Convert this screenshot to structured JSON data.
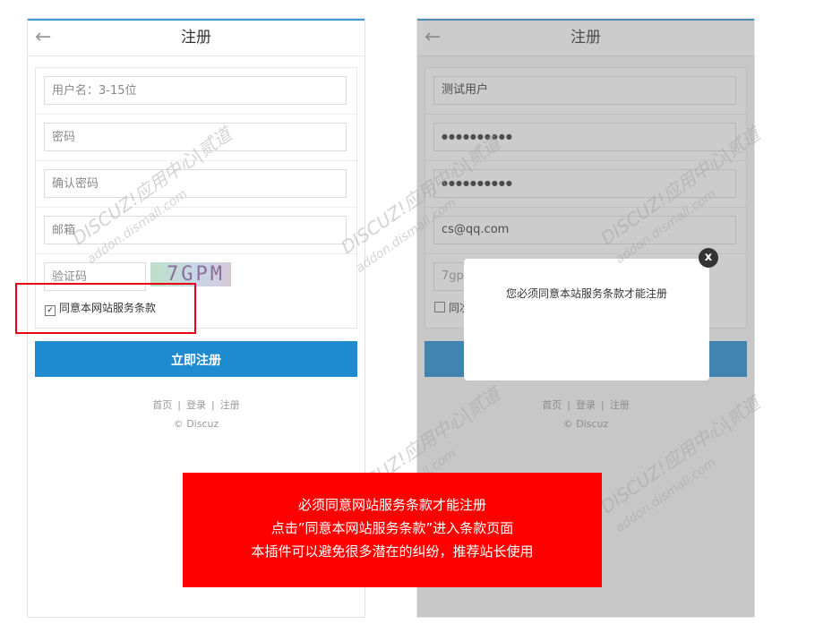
{
  "left_form": {
    "header_title": "注册",
    "username_placeholder": "用户名：3-15位",
    "password_placeholder": "密码",
    "confirm_placeholder": "确认密码",
    "email_placeholder": "邮箱",
    "captcha_placeholder": "验证码",
    "captcha_text": "7GPM",
    "agree_label": "同意本网站服务条款",
    "submit_label": "立即注册",
    "footer_links": [
      "首页",
      "登录",
      "注册"
    ],
    "copyright": "© Discuz"
  },
  "right_form": {
    "header_title": "注册",
    "username_value": "测试用户",
    "password_value": "●●●●●●●●●●",
    "confirm_value": "●●●●●●●●●●",
    "email_value": "cs@qq.com",
    "captcha_value": "7gp",
    "agree_label_partial": "同次",
    "footer_links": [
      "首页",
      "登录",
      "注册"
    ],
    "copyright": "© Discuz",
    "modal_message": "您必须同意本站服务条款才能注册",
    "modal_close": "x"
  },
  "banner": {
    "line1": "必须同意网站服务条款才能注册",
    "line2": "点击”同意本网站服务条款”进入条款页面",
    "line3": "本插件可以避免很多潜在的纠纷，推荐站长使用"
  },
  "watermark": {
    "text": "DISCUZ!应用中心|贰道",
    "subtext": "addon.dismall.com"
  },
  "colors": {
    "accent": "#1e8bd1",
    "header_line": "#3c9bd6",
    "highlight": "#e60012",
    "banner": "#ff0000"
  }
}
